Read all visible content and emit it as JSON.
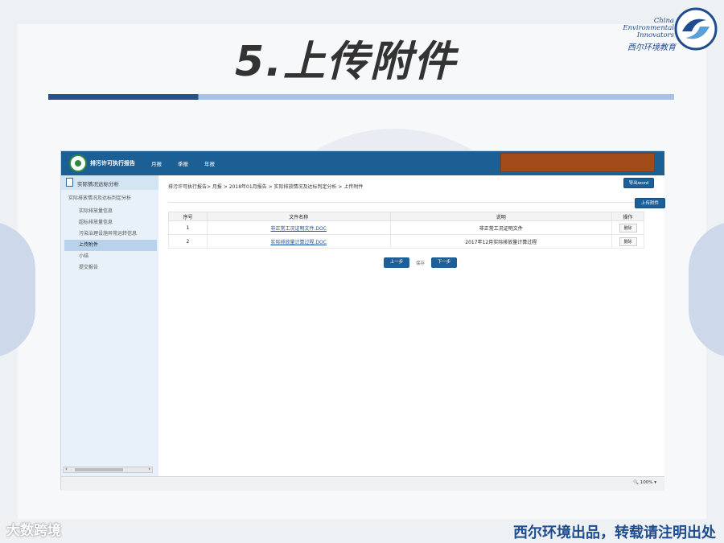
{
  "slide": {
    "title": "5.上传附件",
    "logo_line1": "China",
    "logo_line2": "Environmental",
    "logo_line3": "Innovators",
    "logo_cn": "西尔环境教育"
  },
  "app": {
    "title": "排污许可执行报告",
    "nav": [
      "月报",
      "季报",
      "年报"
    ],
    "sidebar": {
      "header": "实际情况达标分析",
      "group": "实际排放情况及达标判定分析",
      "items": [
        "实际排放量信息",
        "超标排放量信息",
        "污染治理设施异常运转信息",
        "上传附件",
        "小结",
        "提交报告"
      ],
      "active_index": 3
    },
    "breadcrumb": "排污许可执行报告> 月报 > 2018年01月报告 > 实际排放情况及达标判定分析 > 上传附件",
    "export_button": "导出word",
    "upload_button": "上传附件",
    "table": {
      "headers": [
        "序号",
        "文件名称",
        "说明",
        "操作"
      ],
      "rows": [
        {
          "index": "1",
          "file": "非正常工况证明文件.DOC",
          "desc": "非正常工况证明文件",
          "action": "删除"
        },
        {
          "index": "2",
          "file": "实际排放量计算过程.DOC",
          "desc": "2017年12月实际排放量计算过程",
          "action": "删除"
        }
      ]
    },
    "pager": {
      "prev": "上一步",
      "save": "保存",
      "next": "下一步"
    },
    "zoom": "100%"
  },
  "footer": {
    "left": "大数跨境",
    "right": "西尔环境出品，转载请注明出处"
  },
  "colors": {
    "header_blue": "#1c5f95",
    "accent_orange": "#a14a1a",
    "brand_blue": "#1f4c8e"
  }
}
